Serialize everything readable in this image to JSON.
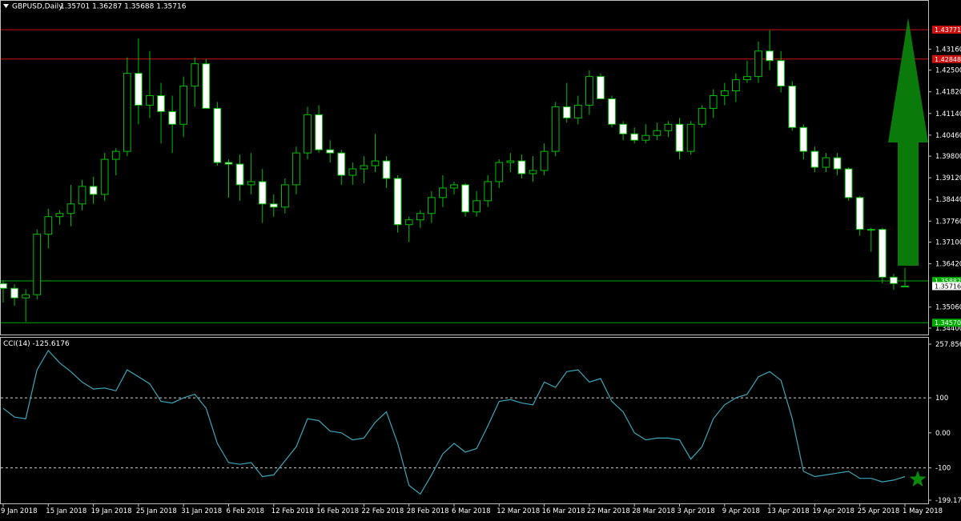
{
  "chart_data": [
    {
      "type": "candlestick",
      "header": {
        "symbol": "GBPUSD,Daily",
        "ohlc": "1.35701 1.36287 1.35688 1.35716"
      },
      "ylim": [
        1.344,
        1.442
      ],
      "y_ticks": [
        "1.43160",
        "1.42500",
        "1.41820",
        "1.41140",
        "1.40460",
        "1.39800",
        "1.39120",
        "1.38440",
        "1.37760",
        "1.37100",
        "1.36420",
        "1.35060",
        "1.34400"
      ],
      "y_tick_values": [
        1.4316,
        1.425,
        1.4182,
        1.4114,
        1.4046,
        1.398,
        1.3912,
        1.3844,
        1.3776,
        1.371,
        1.3642,
        1.3506,
        1.344
      ],
      "horizontal_lines": [
        {
          "value": 1.43771,
          "label": "1.43771",
          "color": "#cc1111"
        },
        {
          "value": 1.42848,
          "label": "1.42848",
          "color": "#cc1111"
        },
        {
          "value": 1.35882,
          "label": "1.35882",
          "color": "#00aa00"
        },
        {
          "value": 1.3457,
          "label": "1.34570",
          "color": "#00aa00"
        }
      ],
      "current_price_label": "1.35716",
      "bull_color": "#000000",
      "bear_color": "#ffffff",
      "wick_color": "#00c000",
      "arrow": {
        "direction": "up",
        "color": "#0a7a0a"
      },
      "candles": [
        [
          1.358,
          1.359,
          1.352,
          1.3565
        ],
        [
          1.3565,
          1.3578,
          1.351,
          1.3535
        ],
        [
          1.3535,
          1.3562,
          1.346,
          1.3545
        ],
        [
          1.3545,
          1.375,
          1.353,
          1.3735
        ],
        [
          1.3735,
          1.3815,
          1.369,
          1.379
        ],
        [
          1.379,
          1.381,
          1.3765,
          1.38
        ],
        [
          1.38,
          1.389,
          1.376,
          1.383
        ],
        [
          1.383,
          1.3905,
          1.381,
          1.3885
        ],
        [
          1.3885,
          1.3915,
          1.383,
          1.386
        ],
        [
          1.386,
          1.399,
          1.384,
          1.397
        ],
        [
          1.397,
          1.4005,
          1.392,
          1.3995
        ],
        [
          1.3995,
          1.429,
          1.398,
          1.424
        ],
        [
          1.424,
          1.435,
          1.408,
          1.414
        ],
        [
          1.414,
          1.431,
          1.41,
          1.417
        ],
        [
          1.417,
          1.421,
          1.402,
          1.412
        ],
        [
          1.412,
          1.417,
          1.399,
          1.408
        ],
        [
          1.408,
          1.423,
          1.404,
          1.42
        ],
        [
          1.42,
          1.429,
          1.4135,
          1.427
        ],
        [
          1.427,
          1.4285,
          1.413,
          1.413
        ],
        [
          1.413,
          1.415,
          1.395,
          1.396
        ],
        [
          1.396,
          1.397,
          1.385,
          1.3955
        ],
        [
          1.3955,
          1.3985,
          1.384,
          1.389
        ],
        [
          1.389,
          1.399,
          1.386,
          1.39
        ],
        [
          1.39,
          1.394,
          1.377,
          1.383
        ],
        [
          1.383,
          1.386,
          1.379,
          1.382
        ],
        [
          1.382,
          1.391,
          1.38,
          1.389
        ],
        [
          1.389,
          1.401,
          1.386,
          1.399
        ],
        [
          1.399,
          1.4135,
          1.397,
          1.411
        ],
        [
          1.411,
          1.414,
          1.399,
          1.4
        ],
        [
          1.4,
          1.403,
          1.396,
          1.399
        ],
        [
          1.399,
          1.4,
          1.389,
          1.392
        ],
        [
          1.392,
          1.396,
          1.389,
          1.394
        ],
        [
          1.394,
          1.398,
          1.3895,
          1.395
        ],
        [
          1.395,
          1.405,
          1.393,
          1.3965
        ],
        [
          1.3965,
          1.398,
          1.388,
          1.391
        ],
        [
          1.391,
          1.392,
          1.374,
          1.3765
        ],
        [
          1.3765,
          1.379,
          1.371,
          1.378
        ],
        [
          1.378,
          1.381,
          1.3755,
          1.38
        ],
        [
          1.38,
          1.387,
          1.377,
          1.385
        ],
        [
          1.385,
          1.392,
          1.382,
          1.388
        ],
        [
          1.388,
          1.39,
          1.386,
          1.389
        ],
        [
          1.389,
          1.3895,
          1.379,
          1.3805
        ],
        [
          1.3805,
          1.387,
          1.379,
          1.384
        ],
        [
          1.384,
          1.392,
          1.382,
          1.39
        ],
        [
          1.39,
          1.397,
          1.388,
          1.396
        ],
        [
          1.396,
          1.399,
          1.393,
          1.3965
        ],
        [
          1.3965,
          1.3985,
          1.391,
          1.3925
        ],
        [
          1.3925,
          1.398,
          1.39,
          1.3935
        ],
        [
          1.3935,
          1.402,
          1.392,
          1.3995
        ],
        [
          1.3995,
          1.415,
          1.398,
          1.4135
        ],
        [
          1.4135,
          1.421,
          1.4085,
          1.41
        ],
        [
          1.41,
          1.417,
          1.408,
          1.414
        ],
        [
          1.414,
          1.425,
          1.411,
          1.423
        ],
        [
          1.423,
          1.424,
          1.416,
          1.416
        ],
        [
          1.416,
          1.417,
          1.407,
          1.408
        ],
        [
          1.408,
          1.409,
          1.403,
          1.405
        ],
        [
          1.405,
          1.407,
          1.402,
          1.403
        ],
        [
          1.403,
          1.408,
          1.402,
          1.4045
        ],
        [
          1.4045,
          1.4085,
          1.403,
          1.406
        ],
        [
          1.406,
          1.409,
          1.404,
          1.408
        ],
        [
          1.408,
          1.41,
          1.397,
          1.3995
        ],
        [
          1.3995,
          1.409,
          1.3985,
          1.408
        ],
        [
          1.408,
          1.414,
          1.407,
          1.413
        ],
        [
          1.413,
          1.419,
          1.41,
          1.417
        ],
        [
          1.417,
          1.421,
          1.414,
          1.4185
        ],
        [
          1.4185,
          1.424,
          1.415,
          1.422
        ],
        [
          1.422,
          1.428,
          1.421,
          1.423
        ],
        [
          1.423,
          1.434,
          1.421,
          1.431
        ],
        [
          1.431,
          1.4375,
          1.425,
          1.428
        ],
        [
          1.428,
          1.431,
          1.418,
          1.42
        ],
        [
          1.42,
          1.4215,
          1.406,
          1.407
        ],
        [
          1.407,
          1.408,
          1.397,
          1.3995
        ],
        [
          1.3995,
          1.401,
          1.393,
          1.3945
        ],
        [
          1.3945,
          1.399,
          1.393,
          1.3975
        ],
        [
          1.3975,
          1.399,
          1.392,
          1.394
        ],
        [
          1.394,
          1.3945,
          1.384,
          1.385
        ],
        [
          1.385,
          1.3855,
          1.373,
          1.375
        ],
        [
          1.375,
          1.3755,
          1.368,
          1.375
        ],
        [
          1.375,
          1.3755,
          1.358,
          1.36
        ],
        [
          1.36,
          1.361,
          1.356,
          1.358
        ],
        [
          1.357,
          1.3629,
          1.3569,
          1.3572
        ]
      ],
      "x_ticks": [
        {
          "label": "9 Jan 2018",
          "index": 0
        },
        {
          "label": "15 Jan 2018",
          "index": 4
        },
        {
          "label": "19 Jan 2018",
          "index": 8
        },
        {
          "label": "25 Jan 2018",
          "index": 12
        },
        {
          "label": "31 Jan 2018",
          "index": 16
        },
        {
          "label": "6 Feb 2018",
          "index": 20
        },
        {
          "label": "12 Feb 2018",
          "index": 24
        },
        {
          "label": "16 Feb 2018",
          "index": 28
        },
        {
          "label": "22 Feb 2018",
          "index": 32
        },
        {
          "label": "28 Feb 2018",
          "index": 36
        },
        {
          "label": "6 Mar 2018",
          "index": 40
        },
        {
          "label": "12 Mar 2018",
          "index": 44
        },
        {
          "label": "16 Mar 2018",
          "index": 48
        },
        {
          "label": "22 Mar 2018",
          "index": 52
        },
        {
          "label": "28 Mar 2018",
          "index": 56
        },
        {
          "label": "3 Apr 2018",
          "index": 60
        },
        {
          "label": "9 Apr 2018",
          "index": 64
        },
        {
          "label": "13 Apr 2018",
          "index": 68
        },
        {
          "label": "19 Apr 2018",
          "index": 72
        },
        {
          "label": "25 Apr 2018",
          "index": 76
        },
        {
          "label": "1 May 2018",
          "index": 80
        }
      ]
    },
    {
      "type": "line",
      "title": "CCI(14) -125.6176",
      "ylim": [
        -199.1716,
        257.856
      ],
      "y_ticks": [
        "257.856",
        "100",
        "0.00",
        "-100",
        "-199.1716"
      ],
      "y_tick_values": [
        257.856,
        100,
        0,
        -100,
        -199.1716
      ],
      "dashed_levels": [
        100,
        -100
      ],
      "line_color": "#3aa6b9",
      "marker": {
        "shape": "star",
        "color": "#0a8a0a"
      },
      "series": [
        {
          "values": [
            70,
            45,
            40,
            180,
            235,
            200,
            175,
            145,
            125,
            128,
            120,
            180,
            160,
            140,
            90,
            85,
            100,
            110,
            70,
            -30,
            -85,
            -90,
            -85,
            -125,
            -120,
            -80,
            -40,
            40,
            35,
            5,
            0,
            -20,
            -15,
            30,
            60,
            -30,
            -150,
            -175,
            -120,
            -60,
            -30,
            -55,
            -45,
            20,
            90,
            95,
            85,
            80,
            145,
            130,
            175,
            180,
            145,
            155,
            90,
            60,
            0,
            -20,
            -15,
            -15,
            -20,
            -75,
            -40,
            40,
            80,
            100,
            110,
            160,
            175,
            150,
            40,
            -110,
            -125,
            -120,
            -115,
            -110,
            -130,
            -130,
            -140,
            -135,
            -125
          ]
        }
      ]
    }
  ]
}
